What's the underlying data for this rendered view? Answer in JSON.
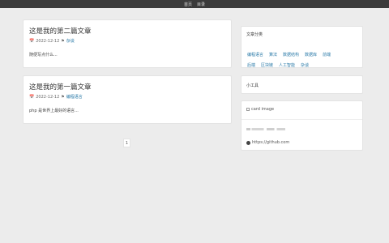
{
  "nav": {
    "items": [
      "首页",
      "目录"
    ]
  },
  "posts": [
    {
      "title": "这是我的第二篇文章",
      "date": "2022-12-12",
      "category": "杂谈",
      "excerpt": "随便写点什么..."
    },
    {
      "title": "这是我的第一篇文章",
      "date": "2022-12-12",
      "category": "编程语言",
      "excerpt": "php 是世界上最好的语言..."
    }
  ],
  "pagination": {
    "current": "1"
  },
  "sidebar": {
    "categories": {
      "title": "文章分类",
      "tags": [
        "编程语言",
        "算法",
        "数据结构",
        "数据库",
        "前端",
        "后端",
        "区块链",
        "人工智能",
        "杂谈"
      ]
    },
    "tools": {
      "title": "小工具"
    },
    "profile": {
      "image_alt": "card image",
      "github": "https://github.com"
    }
  },
  "icons": {
    "calendar": "calendar-icon",
    "tag": "tag-icon",
    "github": "github-icon"
  },
  "colors": {
    "link": "#2a7aa8",
    "topbar": "#3b3b3b",
    "background": "#ececec"
  }
}
